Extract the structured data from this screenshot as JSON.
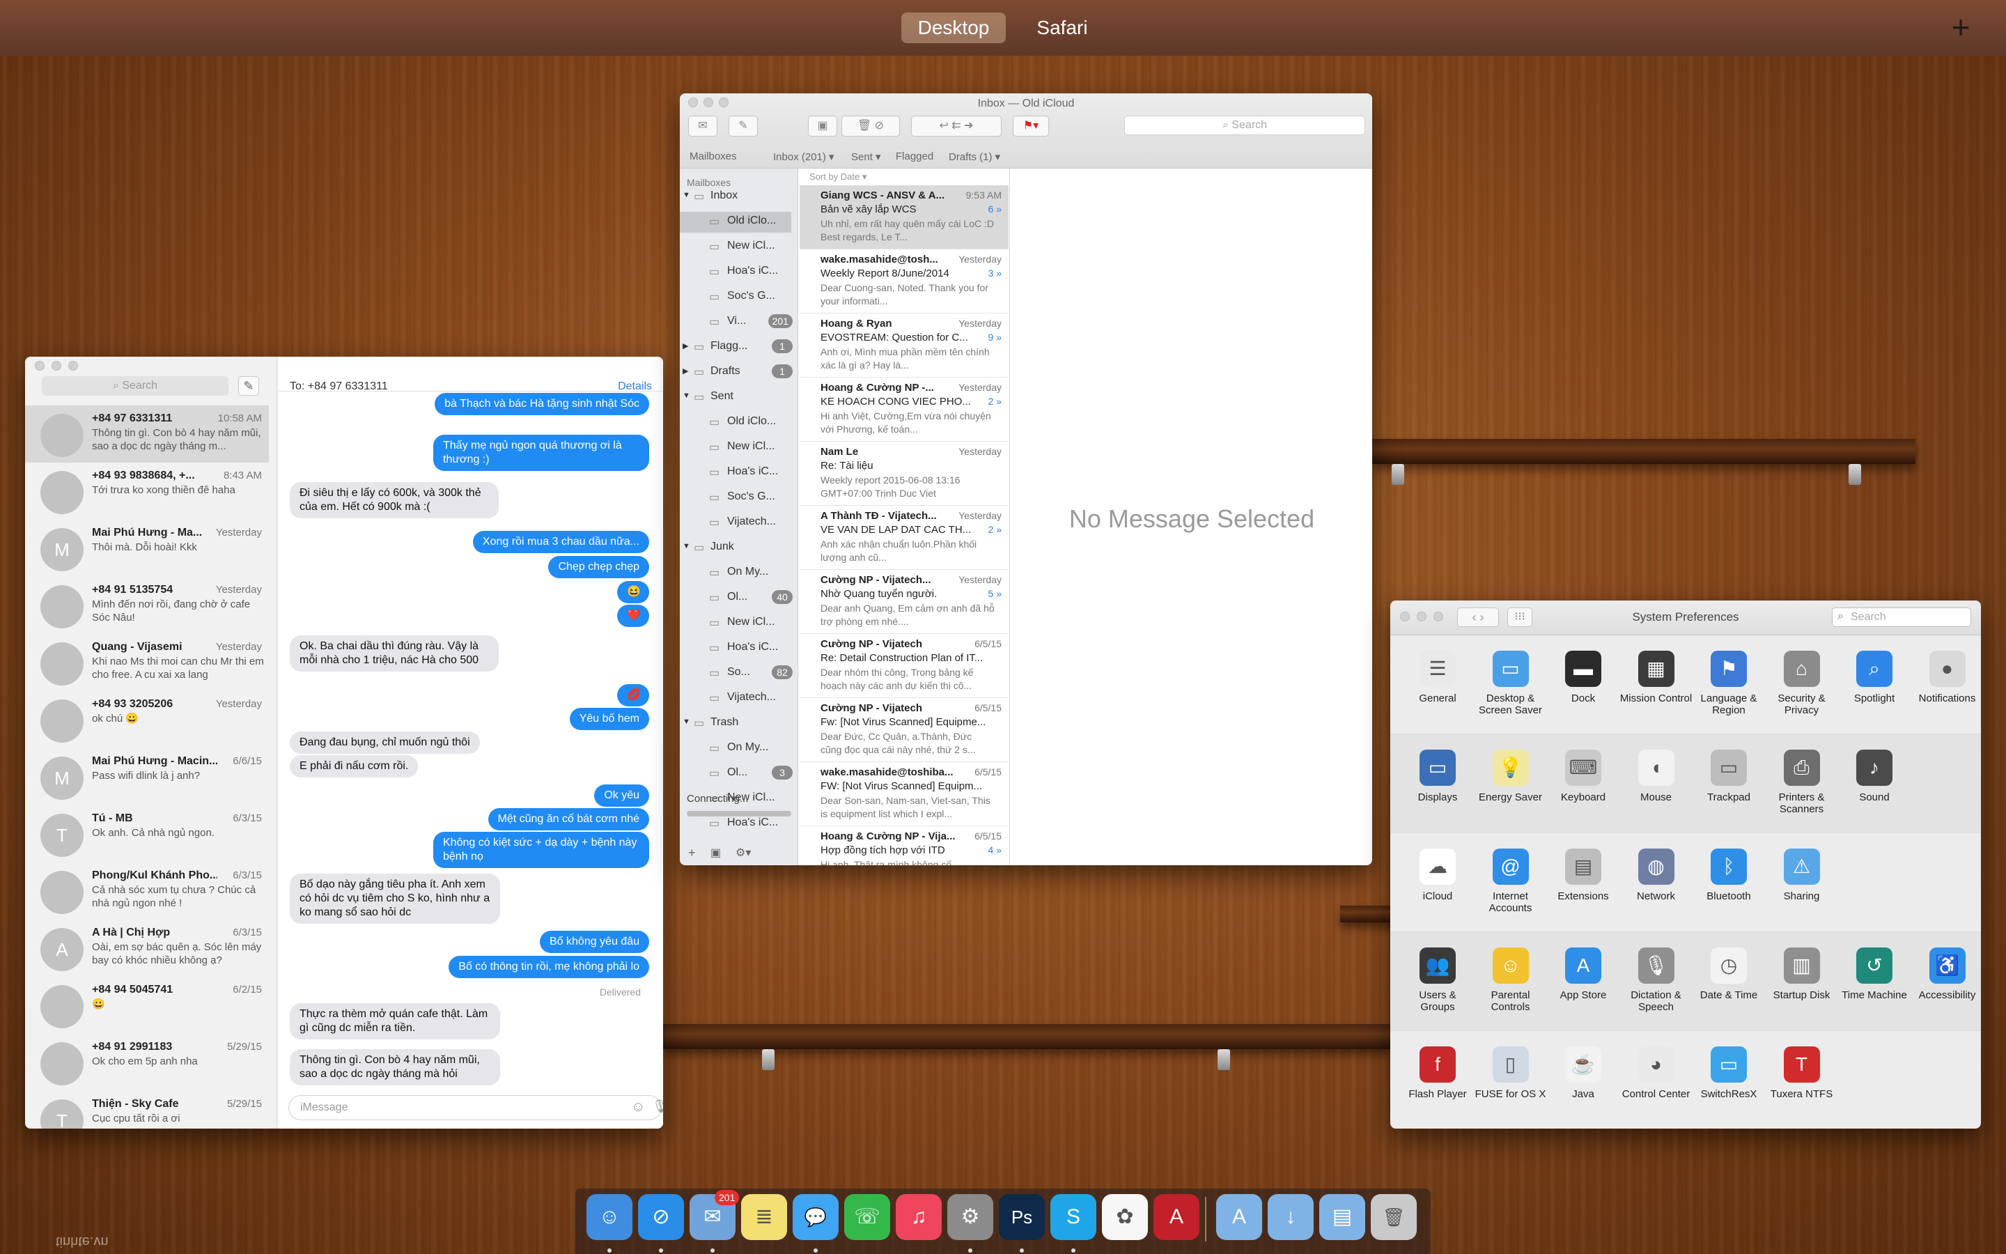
{
  "top_bar": {
    "desktop_tab": "Desktop",
    "safari_tab": "Safari",
    "add_space": "+"
  },
  "messages": {
    "search_placeholder": "Search",
    "to_label": "To:  +84 97 6331311",
    "details_link": "Details",
    "input_placeholder": "iMessage",
    "delivered": "Delivered",
    "conversations": [
      {
        "name": "+84 97 6331311",
        "time": "10:58 AM",
        "preview": "Thông tin gì. Con bò 4 hay năm mũi, sao a dọc dc ngày tháng m...",
        "avatar": ""
      },
      {
        "name": "+84 93 9838684, +...",
        "time": "8:43 AM",
        "preview": "Tới trưa ko xong thiền đê haha",
        "avatar": ""
      },
      {
        "name": "Mai Phú Hưng - Ma...",
        "time": "Yesterday",
        "preview": "Thôi mà. Dỗi hoài! Kkk",
        "avatar": "M"
      },
      {
        "name": "+84 91 5135754",
        "time": "Yesterday",
        "preview": "Mình đến nơi rồi, đang chờ ở cafe Sóc Nâu!",
        "avatar": ""
      },
      {
        "name": "Quang - Vijasemi",
        "time": "Yesterday",
        "preview": "Khi nao Ms thi moi can chu Mr thi em cho free. A cu xai xa lang",
        "avatar": ""
      },
      {
        "name": "+84 93 3205206",
        "time": "Yesterday",
        "preview": "ok chú 😀",
        "avatar": ""
      },
      {
        "name": "Mai Phú Hưng - Macin...",
        "time": "6/6/15",
        "preview": "Pass wifi dlink là j anh?",
        "avatar": "M"
      },
      {
        "name": "Tú - MB",
        "time": "6/3/15",
        "preview": "Ok anh. Cả nhà ngủ ngon.",
        "avatar": "T"
      },
      {
        "name": "Phong/Kul Khánh Pho...",
        "time": "6/3/15",
        "preview": "Cả nhà sóc xum tụ chưa ? Chúc cả nhà ngủ ngon nhé !",
        "avatar": ""
      },
      {
        "name": "A Hà | Chị Hợp",
        "time": "6/3/15",
        "preview": "Oài, em sợ bác quên ạ. Sóc lên máy bay có khóc nhiều không ạ?",
        "avatar": "A"
      },
      {
        "name": "+84 94 5045741",
        "time": "6/2/15",
        "preview": "😀",
        "avatar": ""
      },
      {
        "name": "+84 91 2991183",
        "time": "5/29/15",
        "preview": "Ok cho em 5p anh nha",
        "avatar": ""
      },
      {
        "name": "Thiện - Sky Cafe",
        "time": "5/29/15",
        "preview": "Cục cpu tất rồi a ơi",
        "avatar": "T"
      }
    ],
    "bubbles": [
      {
        "from": "me",
        "text": "bà Thạch và bác Hà tặng sinh nhật Sóc"
      },
      {
        "from": "me",
        "text": "Thấy mẹ ngủ ngon quá thương ơi là thương :)"
      },
      {
        "from": "them",
        "text": "Đi siêu thị e lấy có 600k, và 300k thẻ của em. Hết có 900k mà :("
      },
      {
        "from": "me",
        "text": "Xong rồi mua 3 chau dầu nữa..."
      },
      {
        "from": "me",
        "text": "Chẹp chẹp chẹp"
      },
      {
        "from": "me",
        "text": "😆"
      },
      {
        "from": "me",
        "text": "❤️"
      },
      {
        "from": "them",
        "text": "Ok. Ba chai dầu thì đúng ràu. Vậy là mỗi nhà cho 1 triệu, nác Hà cho 500"
      },
      {
        "from": "me",
        "text": "💋"
      },
      {
        "from": "me",
        "text": "Yêu bố hem"
      },
      {
        "from": "them",
        "text": "Đang đau bụng, chỉ muốn ngủ thôi"
      },
      {
        "from": "them",
        "text": "E phải đi nấu cơm rồi."
      },
      {
        "from": "me",
        "text": "Ok yêu"
      },
      {
        "from": "me",
        "text": "Mệt cũng ăn cố bát cơm nhé"
      },
      {
        "from": "me",
        "text": "Không có kiệt sức + dạ dày + bệnh này bệnh nọ"
      },
      {
        "from": "them",
        "text": "Bố dạo này gắng tiêu pha ít. Anh xem có hỏi dc vụ tiêm cho S ko, hình như a ko mang sổ sao hỏi dc"
      },
      {
        "from": "me",
        "text": "Bố không yêu đâu"
      },
      {
        "from": "me",
        "text": "Bố có thông tin rồi, mẹ không phải lo"
      },
      {
        "from": "them",
        "text": "Thực ra thèm mở quán cafe thật. Làm gì cũng dc miễn ra tiền."
      },
      {
        "from": "them",
        "text": "Thông tin gì. Con bò 4 hay năm mũi, sao a dọc dc ngày tháng mà hỏi"
      }
    ]
  },
  "mail": {
    "title": "Inbox — Old iCloud",
    "search_placeholder": "Search",
    "favorites": [
      "Mailboxes",
      "Inbox (201) ▾",
      "Sent ▾",
      "Flagged",
      "Drafts (1) ▾"
    ],
    "sort_label": "Sort by Date ▾",
    "sidebar_header": "Mailboxes",
    "connecting": "Connecting...",
    "mailboxes": [
      {
        "label": "Inbox",
        "level": 0,
        "badge": "",
        "arrow": "▼"
      },
      {
        "label": "Old iClo...",
        "level": 1,
        "badge": "",
        "arrow": ""
      },
      {
        "label": "New iCl...",
        "level": 1,
        "badge": "",
        "arrow": ""
      },
      {
        "label": "Hoa's iC...",
        "level": 1,
        "badge": "",
        "arrow": ""
      },
      {
        "label": "Soc's G...",
        "level": 1,
        "badge": "",
        "arrow": ""
      },
      {
        "label": "Vi...",
        "level": 1,
        "badge": "201",
        "arrow": ""
      },
      {
        "label": "Flagg...",
        "level": 0,
        "badge": "1",
        "arrow": "▶"
      },
      {
        "label": "Drafts",
        "level": 0,
        "badge": "1",
        "arrow": "▶"
      },
      {
        "label": "Sent",
        "level": 0,
        "badge": "",
        "arrow": "▼"
      },
      {
        "label": "Old iClo...",
        "level": 1,
        "badge": "",
        "arrow": ""
      },
      {
        "label": "New iCl...",
        "level": 1,
        "badge": "",
        "arrow": ""
      },
      {
        "label": "Hoa's iC...",
        "level": 1,
        "badge": "",
        "arrow": ""
      },
      {
        "label": "Soc's G...",
        "level": 1,
        "badge": "",
        "arrow": ""
      },
      {
        "label": "Vijatech...",
        "level": 1,
        "badge": "",
        "arrow": ""
      },
      {
        "label": "Junk",
        "level": 0,
        "badge": "",
        "arrow": "▼"
      },
      {
        "label": "On My...",
        "level": 1,
        "badge": "",
        "arrow": ""
      },
      {
        "label": "Ol...",
        "level": 1,
        "badge": "40",
        "arrow": ""
      },
      {
        "label": "New iCl...",
        "level": 1,
        "badge": "",
        "arrow": ""
      },
      {
        "label": "Hoa's iC...",
        "level": 1,
        "badge": "",
        "arrow": ""
      },
      {
        "label": "So...",
        "level": 1,
        "badge": "82",
        "arrow": ""
      },
      {
        "label": "Vijatech...",
        "level": 1,
        "badge": "",
        "arrow": ""
      },
      {
        "label": "Trash",
        "level": 0,
        "badge": "",
        "arrow": "▼"
      },
      {
        "label": "On My...",
        "level": 1,
        "badge": "",
        "arrow": ""
      },
      {
        "label": "Ol...",
        "level": 1,
        "badge": "3",
        "arrow": ""
      },
      {
        "label": "New iCl...",
        "level": 1,
        "badge": "",
        "arrow": ""
      },
      {
        "label": "Hoa's iC...",
        "level": 1,
        "badge": "",
        "arrow": ""
      }
    ],
    "messages": [
      {
        "from": "Giang WCS - ANSV & A...",
        "date": "9:53 AM",
        "subject": "Bản vẽ xây lắp WCS",
        "count": "6 »",
        "preview": "Uh nhỉ, em rất hay quên mấy cái LoC :D Best regards, Le T..."
      },
      {
        "from": "wake.masahide@tosh...",
        "date": "Yesterday",
        "subject": "Weekly Report 8/June/2014",
        "count": "3 »",
        "preview": "Dear Cuong-san, Noted. Thank you for your informati..."
      },
      {
        "from": "Hoang & Ryan",
        "date": "Yesterday",
        "subject": "EVOSTREAM: Question for C...",
        "count": "9 »",
        "preview": "Anh ơi, Mình mua phần mềm tên chính xác là gì ạ? Hay là..."
      },
      {
        "from": "Hoang & Cường NP -...",
        "date": "Yesterday",
        "subject": "KE HOACH CONG VIEC PHO...",
        "count": "2 »",
        "preview": "Hi anh Việt, Cường,Em vừa nói chuyện với Phương, kế toán..."
      },
      {
        "from": "Nam Le",
        "date": "Yesterday",
        "subject": "Re: Tài liệu",
        "count": "",
        "preview": "Weekly report 2015-06-08 13:16 GMT+07:00 Trịnh Duc Viet"
      },
      {
        "from": "A Thành TĐ - Vijatech...",
        "date": "Yesterday",
        "subject": "VE VAN DE LAP DAT CAC TH...",
        "count": "2 »",
        "preview": "Anh xác nhận chuẩn luôn.Phần khối lượng anh cũ..."
      },
      {
        "from": "Cường NP - Vijatech...",
        "date": "Yesterday",
        "subject": "Nhờ Quang tuyển người.",
        "count": "5 »",
        "preview": "Dear anh Quang, Em cảm ơn anh đã hỗ trợ phòng em nhé...."
      },
      {
        "from": "Cường NP - Vijatech",
        "date": "6/5/15",
        "subject": "Re: Detail Construction Plan of IT...",
        "count": "",
        "preview": "Dear nhóm thi công, Trong bảng kế hoạch này các anh dự kiến thi cô..."
      },
      {
        "from": "Cường NP - Vijatech",
        "date": "6/5/15",
        "subject": "Fw: [Not Virus Scanned] Equipme...",
        "count": "",
        "preview": "Dear Đức, Cc Quân, a.Thành, Đức cũng đọc qua cái này nhé, thứ 2 s..."
      },
      {
        "from": "wake.masahide@toshiba...",
        "date": "6/5/15",
        "subject": "FW: [Not Virus Scanned] Equipm...",
        "count": "",
        "preview": "Dear Son-san, Nam-san, Viet-san, This is equipment list which I expl..."
      },
      {
        "from": "Hoang & Cường NP - Vija...",
        "date": "6/5/15",
        "subject": "Hợp đồng tích hợp với ITD",
        "count": "4 »",
        "preview": "Hi anh, Thật ra mình không cố"
      }
    ],
    "no_selection": "No Message Selected"
  },
  "syspref": {
    "title": "System Preferences",
    "search_placeholder": "Search",
    "rows": [
      [
        {
          "label": "General",
          "icon": "general-icon",
          "color": "#e9e9e9",
          "glyph": "☰"
        },
        {
          "label": "Desktop & Screen Saver",
          "icon": "desktop-icon",
          "color": "#4aa0e6",
          "glyph": "▭"
        },
        {
          "label": "Dock",
          "icon": "dock-icon",
          "color": "#2b2b2b",
          "glyph": "▬"
        },
        {
          "label": "Mission Control",
          "icon": "mission-control-icon",
          "color": "#3c3c3c",
          "glyph": "▦"
        },
        {
          "label": "Language & Region",
          "icon": "language-icon",
          "color": "#3d7ad6",
          "glyph": "⚑"
        },
        {
          "label": "Security & Privacy",
          "icon": "security-icon",
          "color": "#8b8b8b",
          "glyph": "⌂"
        },
        {
          "label": "Spotlight",
          "icon": "spotlight-icon",
          "color": "#2f86e8",
          "glyph": "⌕"
        },
        {
          "label": "Notifications",
          "icon": "notifications-icon",
          "color": "#d9d9d9",
          "glyph": "●"
        }
      ],
      [
        {
          "label": "Displays",
          "icon": "displays-icon",
          "color": "#3b6fb8",
          "glyph": "▭"
        },
        {
          "label": "Energy Saver",
          "icon": "energy-icon",
          "color": "#f2e7a0",
          "glyph": "💡"
        },
        {
          "label": "Keyboard",
          "icon": "keyboard-icon",
          "color": "#c9c9c9",
          "glyph": "⌨"
        },
        {
          "label": "Mouse",
          "icon": "mouse-icon",
          "color": "#f2f2f2",
          "glyph": "◖"
        },
        {
          "label": "Trackpad",
          "icon": "trackpad-icon",
          "color": "#bdbdbd",
          "glyph": "▭"
        },
        {
          "label": "Printers & Scanners",
          "icon": "printer-icon",
          "color": "#6e6e6e",
          "glyph": "⎙"
        },
        {
          "label": "Sound",
          "icon": "sound-icon",
          "color": "#4b4b4b",
          "glyph": "♪"
        }
      ],
      [
        {
          "label": "iCloud",
          "icon": "icloud-icon",
          "color": "#ffffff",
          "glyph": "☁"
        },
        {
          "label": "Internet Accounts",
          "icon": "internet-accounts-icon",
          "color": "#2f8ee8",
          "glyph": "@"
        },
        {
          "label": "Extensions",
          "icon": "extensions-icon",
          "color": "#bdbdbd",
          "glyph": "▤"
        },
        {
          "label": "Network",
          "icon": "network-icon",
          "color": "#6f7fa3",
          "glyph": "◍"
        },
        {
          "label": "Bluetooth",
          "icon": "bluetooth-icon",
          "color": "#2f8ee8",
          "glyph": "ᛒ"
        },
        {
          "label": "Sharing",
          "icon": "sharing-icon",
          "color": "#5aa7e8",
          "glyph": "⚠"
        }
      ],
      [
        {
          "label": "Users & Groups",
          "icon": "users-icon",
          "color": "#3a3a3a",
          "glyph": "👥"
        },
        {
          "label": "Parental Controls",
          "icon": "parental-icon",
          "color": "#f2c12e",
          "glyph": "☺"
        },
        {
          "label": "App Store",
          "icon": "app-store-icon",
          "color": "#2f8ee8",
          "glyph": "A"
        },
        {
          "label": "Dictation & Speech",
          "icon": "dictation-icon",
          "color": "#8f8f8f",
          "glyph": "🎙"
        },
        {
          "label": "Date & Time",
          "icon": "date-time-icon",
          "color": "#f2f2f2",
          "glyph": "◷"
        },
        {
          "label": "Startup Disk",
          "icon": "startup-disk-icon",
          "color": "#8f8f8f",
          "glyph": "▥"
        },
        {
          "label": "Time Machine",
          "icon": "time-machine-icon",
          "color": "#1f8a7a",
          "glyph": "↺"
        },
        {
          "label": "Accessibility",
          "icon": "accessibility-icon",
          "color": "#2f8ee8",
          "glyph": "♿"
        }
      ],
      [
        {
          "label": "Flash Player",
          "icon": "flash-icon",
          "color": "#c9282d",
          "glyph": "f"
        },
        {
          "label": "FUSE for OS X",
          "icon": "fuse-icon",
          "color": "#cfd8e3",
          "glyph": "▯"
        },
        {
          "label": "Java",
          "icon": "java-icon",
          "color": "#f2f2f2",
          "glyph": "☕"
        },
        {
          "label": "Control Center",
          "icon": "logitech-icon",
          "color": "#e9e9e9",
          "glyph": "◕"
        },
        {
          "label": "SwitchResX",
          "icon": "switchresx-icon",
          "color": "#3ba4e8",
          "glyph": "▭"
        },
        {
          "label": "Tuxera NTFS",
          "icon": "tuxera-icon",
          "color": "#d22b2b",
          "glyph": "T"
        }
      ]
    ]
  },
  "dock": {
    "mail_badge": "201",
    "apps": [
      {
        "icon": "finder-icon",
        "color": "#3f8de0",
        "glyph": "☺"
      },
      {
        "icon": "safari-icon",
        "color": "#2a8ee8",
        "glyph": "⊘"
      },
      {
        "icon": "mail-icon",
        "color": "#6fa3d9",
        "glyph": "✉"
      },
      {
        "icon": "notes-icon",
        "color": "#f3df72",
        "glyph": "≣"
      },
      {
        "icon": "messages-icon",
        "color": "#3ea6f2",
        "glyph": "💬"
      },
      {
        "icon": "facetime-icon",
        "color": "#35b84a",
        "glyph": "☏"
      },
      {
        "icon": "itunes-icon",
        "color": "#f0455c",
        "glyph": "♫"
      },
      {
        "icon": "system-preferences-icon",
        "color": "#8b8b8b",
        "glyph": "⚙"
      },
      {
        "icon": "photoshop-icon",
        "color": "#0f2a4a",
        "glyph": "Ps"
      },
      {
        "icon": "skype-icon",
        "color": "#1fa6e8",
        "glyph": "S"
      },
      {
        "icon": "photos-icon",
        "color": "#f7f7f7",
        "glyph": "✿"
      },
      {
        "icon": "autocad-icon",
        "color": "#c2202a",
        "glyph": "A"
      },
      {
        "icon": "applications-folder-icon",
        "color": "#7fb3e6",
        "glyph": "A"
      },
      {
        "icon": "downloads-folder-icon",
        "color": "#7fb3e6",
        "glyph": "↓"
      },
      {
        "icon": "documents-folder-icon",
        "color": "#7fb3e6",
        "glyph": "▤"
      },
      {
        "icon": "trash-icon",
        "color": "#c9c9c9",
        "glyph": "🗑"
      }
    ]
  },
  "watermark": "tinhte.vn"
}
